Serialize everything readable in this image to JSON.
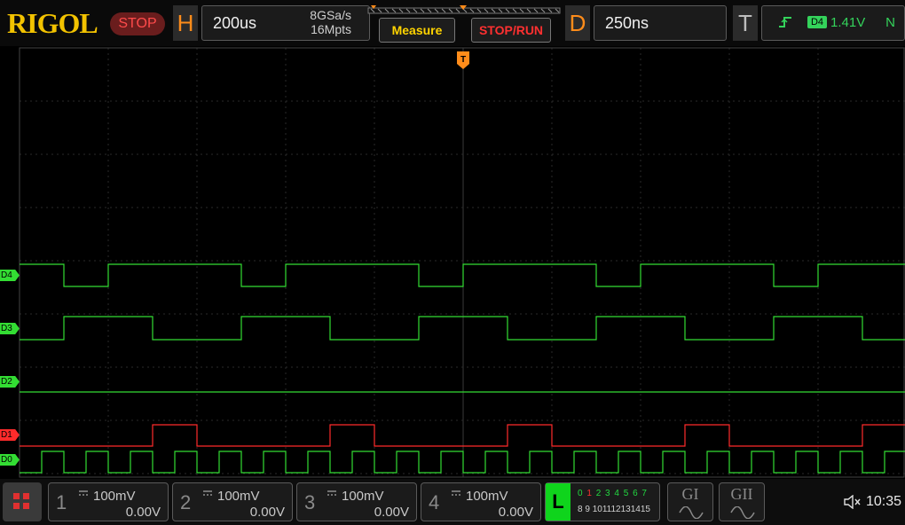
{
  "brand": {
    "logo": "RIGOL"
  },
  "acquisition": {
    "state": "STOP"
  },
  "horizontal": {
    "letter": "H",
    "timebase": "200us",
    "sample_rate": "8GSa/s",
    "memory_depth": "16Mpts"
  },
  "toolbar": {
    "measure_label": "Measure",
    "stoprun_label": "STOP/RUN"
  },
  "delay": {
    "letter": "D",
    "value": "250ns"
  },
  "trigger": {
    "letter": "T",
    "edge_icon": "rising-edge-icon",
    "source": "D4",
    "level": "1.41V",
    "mode": "N",
    "marker": "T"
  },
  "digital_channels": [
    {
      "label": "D4",
      "color": "#33dd33"
    },
    {
      "label": "D3",
      "color": "#33dd33"
    },
    {
      "label": "D2",
      "color": "#33dd33"
    },
    {
      "label": "D1",
      "color": "#ff2b2b"
    },
    {
      "label": "D0",
      "color": "#33dd33"
    }
  ],
  "analog_channels": [
    {
      "number": "1",
      "scale": "100mV",
      "offset": "0.00V"
    },
    {
      "number": "2",
      "scale": "100mV",
      "offset": "0.00V"
    },
    {
      "number": "3",
      "scale": "100mV",
      "offset": "0.00V"
    },
    {
      "number": "4",
      "scale": "100mV",
      "offset": "0.00V"
    }
  ],
  "logic_analyzer": {
    "letter": "L",
    "row1": [
      "0",
      "1",
      "2",
      "3",
      "4",
      "5",
      "6",
      "7"
    ],
    "row2": [
      "8",
      "9",
      "10",
      "11",
      "12",
      "13",
      "14",
      "15"
    ]
  },
  "decoders": [
    {
      "label": "GI",
      "icon": "decode-wave-icon"
    },
    {
      "label": "GII",
      "icon": "decode-wave-icon"
    }
  ],
  "status": {
    "sound_icon": "speaker-muted-icon",
    "time": "10:35"
  },
  "colors": {
    "accent_orange": "#ff8c1a",
    "digital_green": "#33dd33",
    "digital_red": "#ff2b2b",
    "logo_yellow": "#f2c200",
    "stop_red": "#ff4b4b"
  }
}
